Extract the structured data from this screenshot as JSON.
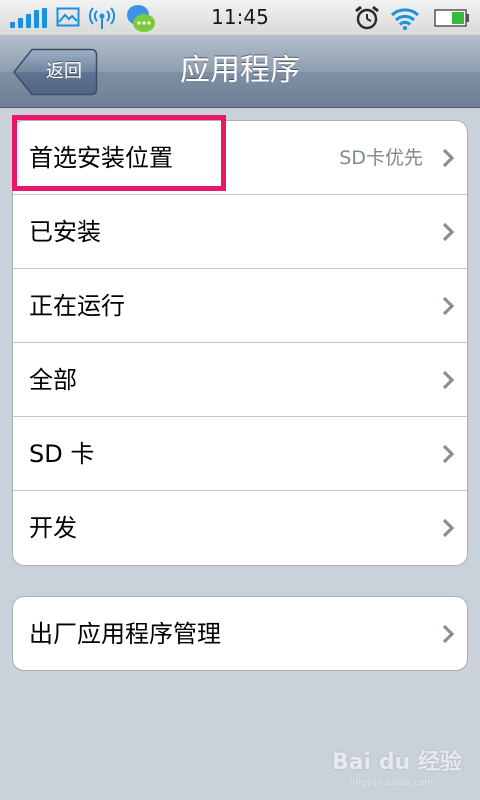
{
  "status_bar": {
    "time": "11:45",
    "icons": [
      "signal-icon",
      "image-icon",
      "hotspot-icon",
      "chat-icon",
      "alarm-icon",
      "wifi-icon",
      "battery-icon"
    ],
    "battery_level": 0.45
  },
  "nav": {
    "back_label": "返回",
    "title": "应用程序"
  },
  "settings": {
    "items": [
      {
        "label": "首选安装位置",
        "value": "SD卡优先"
      },
      {
        "label": "已安装"
      },
      {
        "label": "正在运行"
      },
      {
        "label": "全部"
      },
      {
        "label": "SD 卡"
      },
      {
        "label": "开发"
      }
    ]
  },
  "factory": {
    "label": "出厂应用程序管理"
  },
  "watermark": {
    "main": "Bai du 经验",
    "sub": "jingyan.baidu.com"
  },
  "colors": {
    "accent_highlight": "#e8176a",
    "signal_blue": "#1a90e0",
    "battery_green": "#3cb83c",
    "nav_top": "#b4bfcc",
    "nav_bottom": "#6f8096",
    "background": "#c9d1db"
  }
}
